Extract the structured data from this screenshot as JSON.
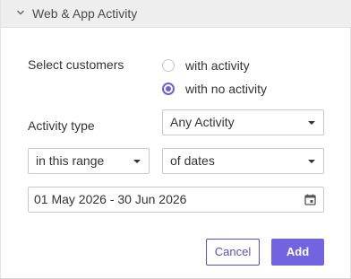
{
  "header": {
    "title": "Web & App Activity",
    "chevron_icon": "chevron-down-icon"
  },
  "customers": {
    "label": "Select customers",
    "options": [
      {
        "label": "with activity",
        "checked": false
      },
      {
        "label": "with no activity",
        "checked": true
      }
    ]
  },
  "activity_type": {
    "label": "Activity type",
    "selected": "Any Activity"
  },
  "range": {
    "operator": "in this range",
    "unit": "of dates"
  },
  "date": {
    "value": "01 May 2026 - 30 Jun 2026",
    "icon": "calendar-icon"
  },
  "actions": {
    "cancel_label": "Cancel",
    "add_label": "Add"
  },
  "colors": {
    "accent": "#6d5fd8",
    "button_primary": "#7264e0",
    "header_bg": "#eeeeee"
  }
}
